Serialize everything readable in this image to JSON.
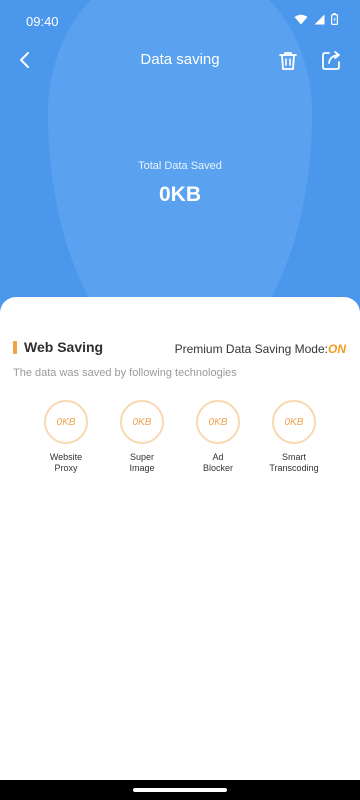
{
  "status_bar": {
    "time": "09:40"
  },
  "header": {
    "title": "Data saving"
  },
  "summary": {
    "label": "Total Data Saved",
    "value": "0KB"
  },
  "web_saving": {
    "title": "Web Saving",
    "premium_label": "Premium Data Saving Mode:",
    "premium_state": "ON",
    "subtitle": "The data was saved by following technologies",
    "technologies": [
      {
        "value": "0KB",
        "label": "Website\nProxy"
      },
      {
        "value": "0KB",
        "label": "Super\nImage"
      },
      {
        "value": "0KB",
        "label": "Ad\nBlocker"
      },
      {
        "value": "0KB",
        "label": "Smart\nTranscoding"
      }
    ]
  },
  "colors": {
    "hero": "#4b97ec",
    "accent": "#f0a24b",
    "premium_on": "#f39b1c"
  }
}
